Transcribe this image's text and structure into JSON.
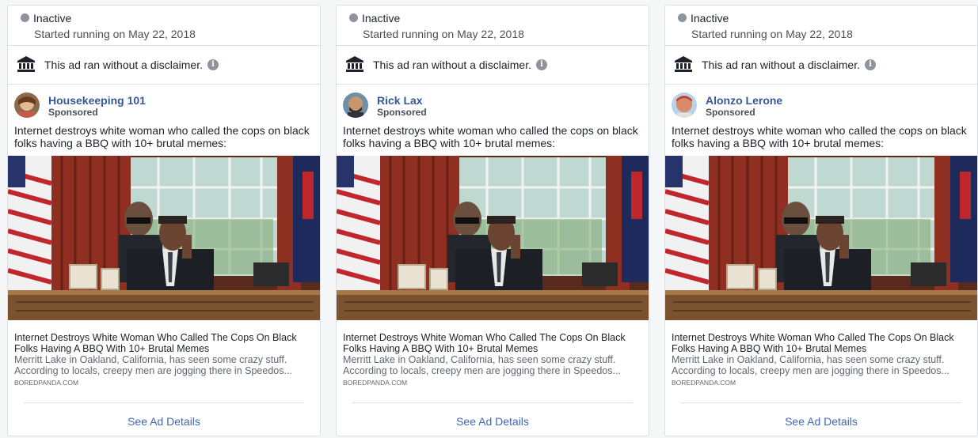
{
  "cards": [
    {
      "status": "Inactive",
      "started": "Started running on May 22, 2018",
      "disclaimer": "This ad ran without a disclaimer.",
      "page_name": "Housekeeping 101",
      "sponsored": "Sponsored",
      "ad_text": "Internet destroys white woman who called the cops on black folks having a BBQ with 10+ brutal memes:",
      "link_title": "Internet Destroys White Woman Who Called The Cops On Black Folks Having A BBQ With 10+ Brutal Memes",
      "link_description": "Merritt Lake in Oakland, California, has seen some crazy stuff. According to locals, creepy men are jogging there in Speedos...",
      "link_domain": "BOREDPANDA.COM",
      "details_label": "See Ad Details"
    },
    {
      "status": "Inactive",
      "started": "Started running on May 22, 2018",
      "disclaimer": "This ad ran without a disclaimer.",
      "page_name": "Rick Lax",
      "sponsored": "Sponsored",
      "ad_text": "Internet destroys white woman who called the cops on black folks having a BBQ with 10+ brutal memes:",
      "link_title": "Internet Destroys White Woman Who Called The Cops On Black Folks Having A BBQ With 10+ Brutal Memes",
      "link_description": "Merritt Lake in Oakland, California, has seen some crazy stuff. According to locals, creepy men are jogging there in Speedos...",
      "link_domain": "BOREDPANDA.COM",
      "details_label": "See Ad Details"
    },
    {
      "status": "Inactive",
      "started": "Started running on May 22, 2018",
      "disclaimer": "This ad ran without a disclaimer.",
      "page_name": "Alonzo Lerone",
      "sponsored": "Sponsored",
      "ad_text": "Internet destroys white woman who called the cops on black folks having a BBQ with 10+ brutal memes:",
      "link_title": "Internet Destroys White Woman Who Called The Cops On Black Folks Having A BBQ With 10+ Brutal Memes",
      "link_description": "Merritt Lake in Oakland, California, has seen some crazy stuff. According to locals, creepy men are jogging there in Speedos...",
      "link_domain": "BOREDPANDA.COM",
      "details_label": "See Ad Details"
    }
  ],
  "icons": {
    "status": "status-dot-icon",
    "disclaimer": "bank-building-icon",
    "info": "info-icon"
  },
  "colors": {
    "link": "#4267b2",
    "page_name": "#365899",
    "inactive_dot": "#8d949e",
    "border": "#dddfe2"
  }
}
